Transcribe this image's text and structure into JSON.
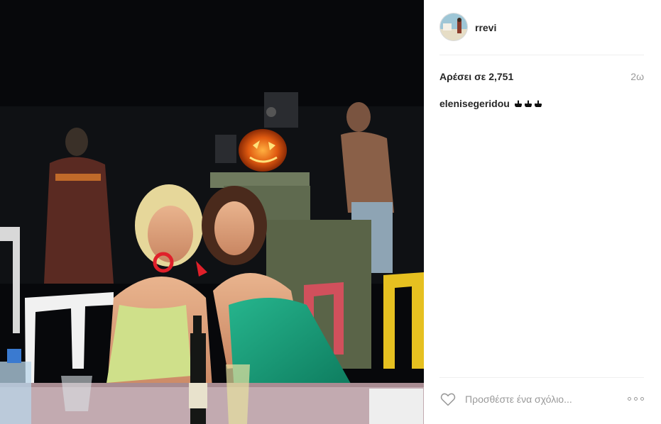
{
  "post": {
    "image_alt": "Two women posing at a table at night in front of a carved pumpkin"
  },
  "header": {
    "username": "rrevi",
    "avatar_icon": "profile-avatar"
  },
  "stats": {
    "likes": "Αρέσει σε 2,751",
    "time": "2ω"
  },
  "caption": {
    "user": "elenisegeridou",
    "emoji_icon": "pointing-hand-icon",
    "emoji_count": 3
  },
  "comment": {
    "placeholder": "Προσθέστε ένα σχόλιο...",
    "like_icon": "heart-icon",
    "more_icon": "more-options-icon"
  },
  "colors": {
    "username": "#262626",
    "meta": "#999999",
    "divider": "#efefef"
  }
}
